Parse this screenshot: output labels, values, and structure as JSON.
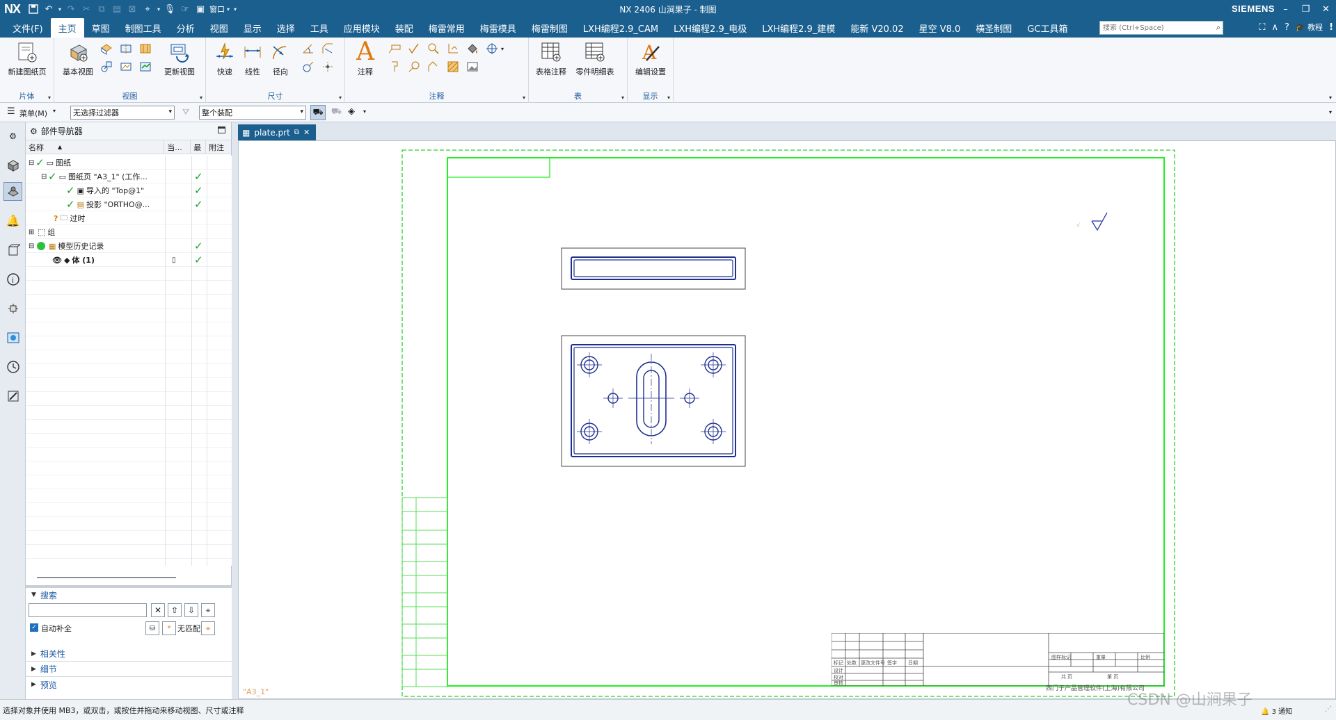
{
  "app": {
    "logo": "NX",
    "title": "NX 2406 山涧果子 - 制图",
    "brand": "SIEMENS",
    "window_menu": "窗口",
    "window_controls": [
      "minimize-icon",
      "restore-icon",
      "close-icon"
    ]
  },
  "menu": {
    "items": [
      "文件(F)",
      "主页",
      "草图",
      "制图工具",
      "分析",
      "视图",
      "显示",
      "选择",
      "工具",
      "应用模块",
      "装配",
      "梅雷常用",
      "梅雷模具",
      "梅雷制图",
      "LXH编程2.9_CAM",
      "LXH编程2.9_电极",
      "LXH编程2.9_建模",
      "能新 V20.02",
      "星空 V8.0",
      "横圣制图",
      "GC工具箱"
    ],
    "active_index": 1,
    "search_placeholder": "搜索 (Ctrl+Space)",
    "tutorial": "教程"
  },
  "ribbon": {
    "groups": [
      {
        "label": "片体",
        "buttons": [
          "新建图纸页"
        ]
      },
      {
        "label": "视图",
        "buttons": [
          "基本视图",
          "更新视图"
        ]
      },
      {
        "label": "尺寸",
        "buttons": [
          "快速",
          "线性",
          "径向"
        ]
      },
      {
        "label": "注释",
        "buttons": [
          "注释"
        ]
      },
      {
        "label": "表",
        "buttons": [
          "表格注释",
          "零件明细表"
        ]
      },
      {
        "label": "显示",
        "buttons": [
          "编辑设置"
        ]
      }
    ]
  },
  "toolbar2": {
    "menu_label": "菜单(M)",
    "filter_value": "无选择过滤器",
    "scope_value": "整个装配"
  },
  "navigator": {
    "title": "部件导航器",
    "columns": [
      "名称",
      "当...",
      "最",
      "附注"
    ],
    "rows": [
      {
        "label": "图纸"
      },
      {
        "label": "图纸页 \"A3_1\" (工作..."
      },
      {
        "label": "导入的 \"Top@1\""
      },
      {
        "label": "投影 \"ORTHO@..."
      },
      {
        "label": "过时"
      },
      {
        "label": "组"
      },
      {
        "label": "模型历史记录"
      },
      {
        "label": "体 (1)"
      }
    ],
    "search": {
      "title": "搜索",
      "auto_complete": "自动补全",
      "no_match": "无匹配"
    },
    "sections": [
      "相关性",
      "细节",
      "预览"
    ]
  },
  "document": {
    "tab": "plate.prt",
    "sheet_name": "\"A3_1\"",
    "company": "西门子产品管理软件(上海)有限公司",
    "tb_labels": [
      "标记",
      "处数",
      "更改文件号",
      "签字",
      "日期",
      "设计",
      "校对",
      "审核",
      "批准",
      "图样标记",
      "重量",
      "比例",
      "共  页",
      "第  页"
    ]
  },
  "status": {
    "message": "选择对象并使用 MB3，或双击，或按住并拖动来移动视图、尺寸或注释",
    "watermark": "CSDN @山涧果子",
    "notify": "3 通知"
  },
  "colors": {
    "chrome": "#1b5f8f",
    "border_green": "#00ff00",
    "geometry_blue": "#1f2f8f",
    "check_green": "#1aa12c"
  }
}
